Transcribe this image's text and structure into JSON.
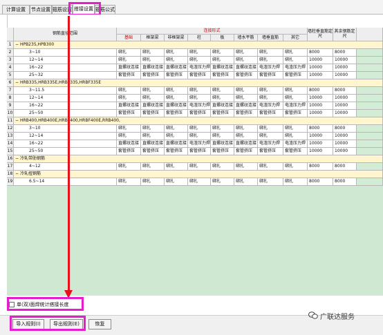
{
  "tabs": [
    "计算设置",
    "节点设置",
    "箍筋设置",
    "搭接设置",
    "箍筋公式"
  ],
  "header": {
    "range_label": "钢筋直径范围",
    "group_label": "连接形式",
    "cols": [
      "基础",
      "框架梁",
      "非框架梁",
      "柱",
      "板",
      "墙水平筋",
      "墙垂直筋",
      "其它"
    ],
    "col_a": "墙柱垂直筋定尺",
    "col_b": "其余钢筋定尺"
  },
  "rows": [
    {
      "n": "1",
      "type": "cat",
      "label": "HPB235,HPB300"
    },
    {
      "n": "2",
      "type": "data",
      "label": "3~10",
      "cells": [
        "绑扎",
        "绑扎",
        "绑扎",
        "绑扎",
        "绑扎",
        "绑扎",
        "绑扎",
        "绑扎"
      ],
      "a": "8000",
      "b": "8000"
    },
    {
      "n": "3",
      "type": "data",
      "label": "12~14",
      "cells": [
        "绑扎",
        "绑扎",
        "绑扎",
        "绑扎",
        "绑扎",
        "绑扎",
        "绑扎",
        "绑扎"
      ],
      "a": "10000",
      "b": "10000"
    },
    {
      "n": "4",
      "type": "data",
      "label": "16~22",
      "cells": [
        "直螺纹连接",
        "直螺纹连接",
        "直螺纹连接",
        "电渣压力焊",
        "直螺纹连接",
        "直螺纹连接",
        "电渣压力焊",
        "电渣压力焊"
      ],
      "a": "10000",
      "b": "10000"
    },
    {
      "n": "5",
      "type": "data",
      "label": "25~32",
      "cells": [
        "套管挤压",
        "套管挤压",
        "套管挤压",
        "套管挤压",
        "套管挤压",
        "套管挤压",
        "套管挤压",
        "套管挤压"
      ],
      "a": "10000",
      "b": "10000"
    },
    {
      "n": "6",
      "type": "cat",
      "label": "HRB335,HRB335E,HRBF335,HRBF335E"
    },
    {
      "n": "7",
      "type": "data",
      "label": "3~11.5",
      "cells": [
        "绑扎",
        "绑扎",
        "绑扎",
        "绑扎",
        "绑扎",
        "绑扎",
        "绑扎",
        "绑扎"
      ],
      "a": "8000",
      "b": "8000"
    },
    {
      "n": "8",
      "type": "data",
      "label": "12~14",
      "cells": [
        "绑扎",
        "绑扎",
        "绑扎",
        "绑扎",
        "绑扎",
        "绑扎",
        "绑扎",
        "绑扎"
      ],
      "a": "10000",
      "b": "10000"
    },
    {
      "n": "9",
      "type": "data",
      "label": "16~22",
      "cells": [
        "直螺纹连接",
        "直螺纹连接",
        "直螺纹连接",
        "电渣压力焊",
        "直螺纹连接",
        "直螺纹连接",
        "电渣压力焊",
        "电渣压力焊"
      ],
      "a": "10000",
      "b": "10000"
    },
    {
      "n": "10",
      "type": "data",
      "label": "25~50",
      "cells": [
        "套管挤压",
        "套管挤压",
        "套管挤压",
        "套管挤压",
        "套管挤压",
        "套管挤压",
        "套管挤压",
        "套管挤压"
      ],
      "a": "10000",
      "b": "10000"
    },
    {
      "n": "11",
      "type": "cat",
      "label": "HRB400,HRB400E,HRBF400,HRBF400E,RRB400,"
    },
    {
      "n": "12",
      "type": "data",
      "label": "3~10",
      "cells": [
        "绑扎",
        "绑扎",
        "绑扎",
        "绑扎",
        "绑扎",
        "绑扎",
        "绑扎",
        "绑扎"
      ],
      "a": "8000",
      "b": "8000"
    },
    {
      "n": "13",
      "type": "data",
      "label": "12~14",
      "cells": [
        "绑扎",
        "绑扎",
        "绑扎",
        "绑扎",
        "绑扎",
        "绑扎",
        "绑扎",
        "绑扎"
      ],
      "a": "10000",
      "b": "10000"
    },
    {
      "n": "14",
      "type": "data",
      "label": "16~22",
      "cells": [
        "直螺纹连接",
        "直螺纹连接",
        "直螺纹连接",
        "电渣压力焊",
        "直螺纹连接",
        "直螺纹连接",
        "电渣压力焊",
        "电渣压力焊"
      ],
      "a": "10000",
      "b": "10000"
    },
    {
      "n": "15",
      "type": "data",
      "label": "25~50",
      "cells": [
        "套管挤压",
        "套管挤压",
        "套管挤压",
        "套管挤压",
        "套管挤压",
        "套管挤压",
        "套管挤压",
        "套管挤压"
      ],
      "a": "10000",
      "b": "10000"
    },
    {
      "n": "16",
      "type": "cat",
      "label": "冷轧带肋钢筋"
    },
    {
      "n": "17",
      "type": "data",
      "label": "4~12",
      "cells": [
        "绑扎",
        "绑扎",
        "绑扎",
        "绑扎",
        "绑扎",
        "绑扎",
        "绑扎",
        "绑扎"
      ],
      "a": "8000",
      "b": "8000"
    },
    {
      "n": "18",
      "type": "cat",
      "label": "冷轧扭钢筋"
    },
    {
      "n": "19",
      "type": "data",
      "label": "6.5~14",
      "cells": [
        "绑扎",
        "绑扎",
        "绑扎",
        "绑扎",
        "绑扎",
        "绑扎",
        "绑扎",
        "绑扎"
      ],
      "a": "8000",
      "b": "8000"
    }
  ],
  "checkbox_label": "单(双)面焊统计搭接长度",
  "buttons": {
    "import": "导入规则(I)",
    "export": "导出规则(E)",
    "restore": "恢复"
  },
  "watermark": "广联达服务",
  "colors": {
    "highlight": "#e61ccf",
    "arrow": "#e8101a"
  }
}
